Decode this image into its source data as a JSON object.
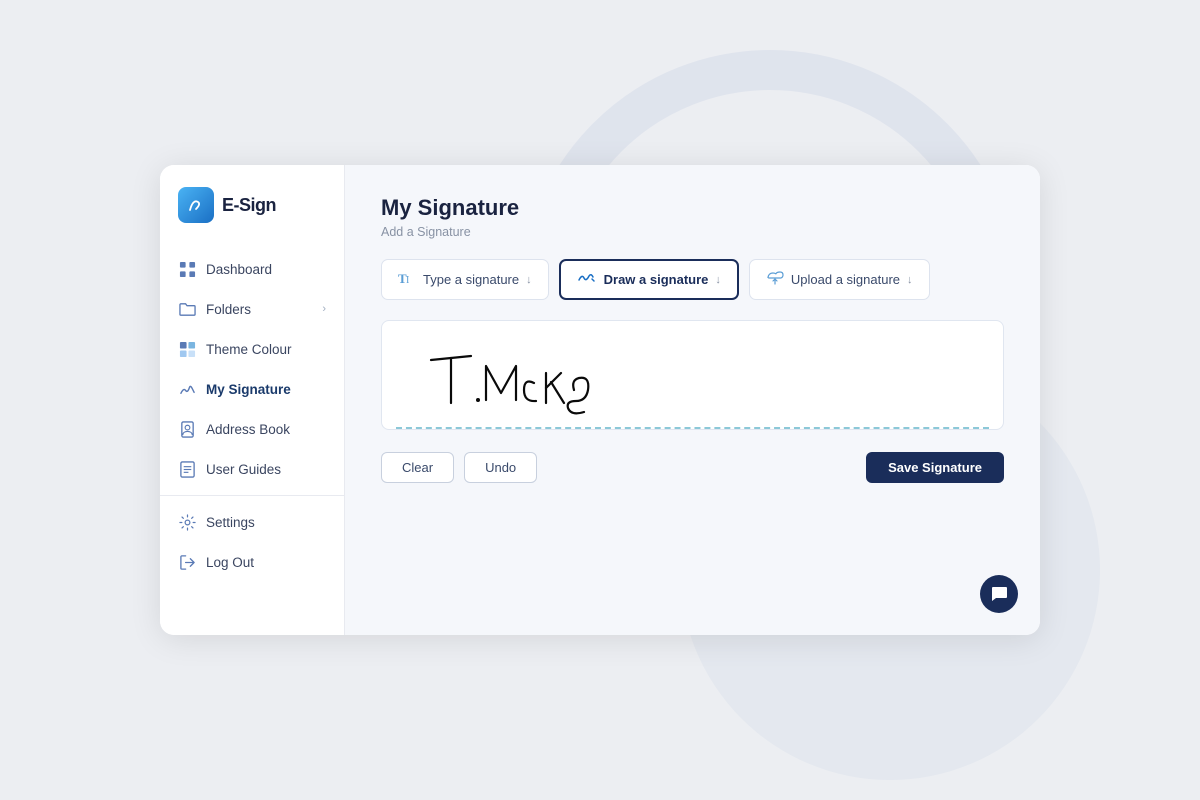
{
  "app": {
    "logo_letter": "ℰ",
    "logo_name": "E-Sign"
  },
  "sidebar": {
    "items": [
      {
        "id": "dashboard",
        "label": "Dashboard",
        "icon": "grid",
        "has_chevron": false
      },
      {
        "id": "folders",
        "label": "Folders",
        "icon": "folder",
        "has_chevron": true
      },
      {
        "id": "theme-colour",
        "label": "Theme Colour",
        "icon": "theme",
        "has_chevron": false
      },
      {
        "id": "my-signature",
        "label": "My Signature",
        "icon": "signature",
        "has_chevron": false,
        "active": true
      },
      {
        "id": "address-book",
        "label": "Address Book",
        "icon": "contacts",
        "has_chevron": false
      },
      {
        "id": "user-guides",
        "label": "User Guides",
        "icon": "book",
        "has_chevron": false
      },
      {
        "id": "settings",
        "label": "Settings",
        "icon": "gear",
        "has_chevron": false
      },
      {
        "id": "log-out",
        "label": "Log Out",
        "icon": "logout",
        "has_chevron": false
      }
    ]
  },
  "main": {
    "page_title": "My Signature",
    "page_subtitle": "Add a Signature",
    "tabs": [
      {
        "id": "type",
        "label": "Type a signature",
        "icon": "type"
      },
      {
        "id": "draw",
        "label": "Draw a signature",
        "icon": "draw",
        "active": true
      },
      {
        "id": "upload",
        "label": "Upload a signature",
        "icon": "upload"
      }
    ],
    "signature_text": "T.McKe",
    "buttons": {
      "clear": "Clear",
      "undo": "Undo",
      "save": "Save Signature"
    }
  }
}
